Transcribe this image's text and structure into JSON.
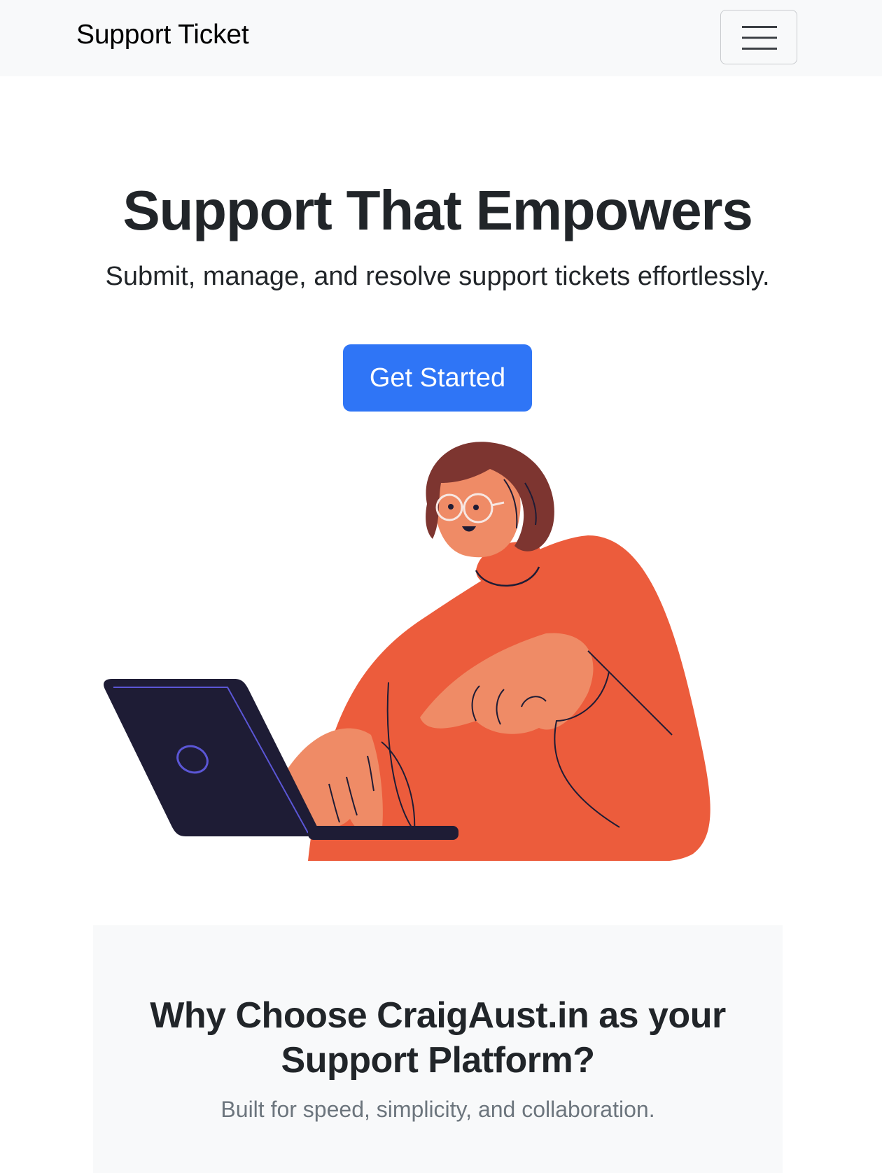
{
  "navbar": {
    "brand": "Support Ticket",
    "toggle_icon": "hamburger-menu-icon"
  },
  "hero": {
    "title": "Support That Empowers",
    "subtitle": "Submit, manage, and resolve support tickets effortlessly.",
    "cta_label": "Get Started",
    "illustration": "woman-at-laptop-illustration"
  },
  "features": {
    "title_line1": "Why Choose CraigAust.in as your",
    "title_line2": "Support Platform?",
    "subtitle": "Built for speed, simplicity, and collaboration."
  },
  "colors": {
    "navbar_bg": "#f8f9fa",
    "primary": "#2f75f6",
    "sweater": "#ec5c3c",
    "skin": "#ef8b66",
    "hair": "#7d3530",
    "laptop": "#1e1c35",
    "text": "#212529",
    "muted": "#6c757d"
  }
}
